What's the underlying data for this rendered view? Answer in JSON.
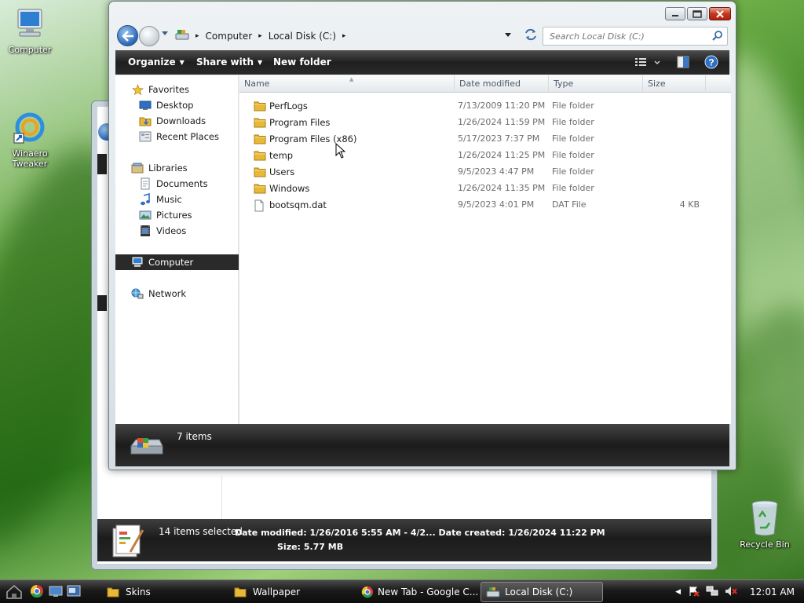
{
  "desktop": {
    "icons": [
      {
        "label": "Computer",
        "icon": "computer-icon"
      },
      {
        "label": "Winaero\nTweaker",
        "icon": "winaero-tweaker-icon"
      },
      {
        "label": "Recycle Bin",
        "icon": "recycle-bin-icon"
      }
    ]
  },
  "background_window": {
    "status_count": "14 items selected",
    "date_modified_label": "Date modified:",
    "date_modified": "1/26/2016 5:55 AM - 4/2...",
    "date_created_label": "Date created:",
    "date_created": "1/26/2024 11:22 PM",
    "size_label": "Size:",
    "size": "5.77 MB"
  },
  "window": {
    "address": {
      "crumbs": [
        "Computer",
        "Local Disk (C:)"
      ],
      "search_placeholder": "Search Local Disk (C:)"
    },
    "commands": {
      "organize": "Organize",
      "share_with": "Share with",
      "new_folder": "New folder"
    },
    "nav": {
      "favorites": "Favorites",
      "desktop": "Desktop",
      "downloads": "Downloads",
      "recent_places": "Recent Places",
      "libraries": "Libraries",
      "documents": "Documents",
      "music": "Music",
      "pictures": "Pictures",
      "videos": "Videos",
      "computer": "Computer",
      "network": "Network"
    },
    "columns": {
      "name": "Name",
      "date_modified": "Date modified",
      "type": "Type",
      "size": "Size"
    },
    "files": [
      {
        "name": "PerfLogs",
        "date": "7/13/2009 11:20 PM",
        "type": "File folder",
        "size": "",
        "icon": "folder-icon"
      },
      {
        "name": "Program Files",
        "date": "1/26/2024 11:59 PM",
        "type": "File folder",
        "size": "",
        "icon": "folder-icon"
      },
      {
        "name": "Program Files (x86)",
        "date": "5/17/2023 7:37 PM",
        "type": "File folder",
        "size": "",
        "icon": "folder-icon"
      },
      {
        "name": "temp",
        "date": "1/26/2024 11:25 PM",
        "type": "File folder",
        "size": "",
        "icon": "folder-icon"
      },
      {
        "name": "Users",
        "date": "9/5/2023 4:47 PM",
        "type": "File folder",
        "size": "",
        "icon": "folder-icon"
      },
      {
        "name": "Windows",
        "date": "1/26/2024 11:35 PM",
        "type": "File folder",
        "size": "",
        "icon": "folder-icon"
      },
      {
        "name": "bootsqm.dat",
        "date": "9/5/2023 4:01 PM",
        "type": "DAT File",
        "size": "4 KB",
        "icon": "file-icon"
      }
    ],
    "status": {
      "item_count": "7 items"
    }
  },
  "taskbar": {
    "buttons": [
      {
        "label": "Skins",
        "icon": "folder-icon"
      },
      {
        "label": "Wallpaper",
        "icon": "folder-icon"
      },
      {
        "label": "New Tab - Google C...",
        "icon": "chrome-icon"
      },
      {
        "label": "Local Disk (C:)",
        "icon": "drive-icon"
      }
    ],
    "clock": "12:01 AM"
  },
  "colors": {
    "folder": "#e8b937",
    "command_bar": "#2a2a2a",
    "selected_nav": "#2a2a2a",
    "accent_blue": "#2a66b6"
  }
}
